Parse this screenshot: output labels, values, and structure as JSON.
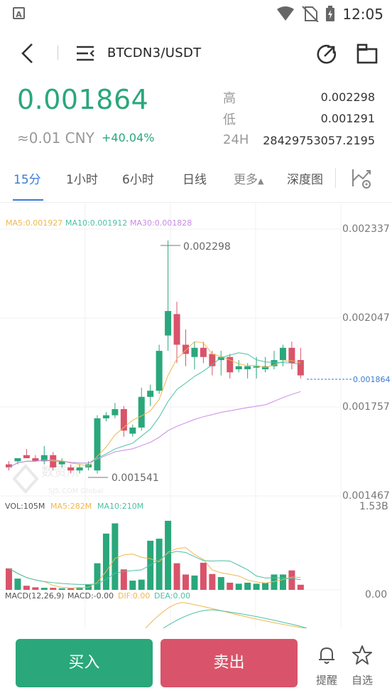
{
  "status_bar": {
    "time": "12:05",
    "app_badge": "A"
  },
  "header": {
    "pair": "BTCDN3/USDT"
  },
  "ticker": {
    "price": "0.001864",
    "cny": "≈0.01 CNY",
    "change": "+40.04%",
    "high_label": "高",
    "high_value": "0.002298",
    "low_label": "低",
    "low_value": "0.001291",
    "vol_label": "24H",
    "vol_value": "28429753057.2195"
  },
  "tabs": [
    {
      "label": "15分"
    },
    {
      "label": "1小时"
    },
    {
      "label": "6小时"
    },
    {
      "label": "日线"
    },
    {
      "label": "更多"
    },
    {
      "label": "深度图"
    }
  ],
  "colors": {
    "up": "#2aa77b",
    "down": "#d9546a",
    "ma5": "#f0b74e",
    "ma10": "#4cc0a5",
    "ma30": "#c98ae8",
    "accent": "#3a7bd5"
  },
  "chart_data": {
    "type": "candlestick",
    "legend": {
      "ma5": "MA5:0.001927",
      "ma10": "MA10:0.001912",
      "ma30": "MA30:0.001828"
    },
    "y_ticks": [
      "0.002337",
      "0.002047",
      "0.001757",
      "0.001467"
    ],
    "ylim": [
      0.001467,
      0.002337
    ],
    "max_label": "0.002298",
    "min_label": "0.001541",
    "last_price_label": "0.001864",
    "watermark": "SJS.COM Global",
    "candles": [
      [
        0.00157,
        0.00158,
        0.00156,
        0.00155
      ],
      [
        0.00158,
        0.00159,
        0.00159,
        0.00157
      ],
      [
        0.0016,
        0.00162,
        0.00159,
        0.00159
      ],
      [
        0.00159,
        0.0016,
        0.00158,
        0.00158
      ],
      [
        0.00158,
        0.00163,
        0.0016,
        0.00157
      ],
      [
        0.0016,
        0.00161,
        0.00156,
        0.00155
      ],
      [
        0.00157,
        0.00159,
        0.00158,
        0.00156
      ],
      [
        0.00156,
        0.00157,
        0.00155,
        0.00154
      ],
      [
        0.00155,
        0.00157,
        0.00156,
        0.00154
      ],
      [
        0.00156,
        0.00158,
        0.00157,
        0.00155
      ],
      [
        0.00155,
        0.00173,
        0.00172,
        0.00154
      ],
      [
        0.00172,
        0.00174,
        0.00173,
        0.00171
      ],
      [
        0.00173,
        0.00177,
        0.00175,
        0.00172
      ],
      [
        0.00175,
        0.00176,
        0.00168,
        0.00166
      ],
      [
        0.00167,
        0.0017,
        0.00169,
        0.00166
      ],
      [
        0.00169,
        0.00182,
        0.00179,
        0.00168
      ],
      [
        0.00179,
        0.00183,
        0.00181,
        0.00176
      ],
      [
        0.00181,
        0.00196,
        0.00194,
        0.0018
      ],
      [
        0.00199,
        0.0023,
        0.00207,
        0.00194
      ],
      [
        0.00206,
        0.0021,
        0.00196,
        0.0019
      ],
      [
        0.00196,
        0.00201,
        0.00193,
        0.00189
      ],
      [
        0.00192,
        0.00197,
        0.00195,
        0.00188
      ],
      [
        0.00195,
        0.00197,
        0.00192,
        0.0019
      ],
      [
        0.00193,
        0.00194,
        0.00189,
        0.00186
      ],
      [
        0.00191,
        0.00194,
        0.00192,
        0.00186
      ],
      [
        0.00192,
        0.00193,
        0.00187,
        0.00185
      ],
      [
        0.00188,
        0.00191,
        0.00189,
        0.00187
      ],
      [
        0.00188,
        0.0019,
        0.00189,
        0.00185
      ],
      [
        0.00189,
        0.00192,
        0.00189,
        0.00185
      ],
      [
        0.00188,
        0.00192,
        0.00189,
        0.00187
      ],
      [
        0.00189,
        0.00194,
        0.00191,
        0.00188
      ],
      [
        0.00191,
        0.00196,
        0.00195,
        0.00189
      ],
      [
        0.00195,
        0.00197,
        0.0019,
        0.00188
      ],
      [
        0.00191,
        0.00195,
        0.00186,
        0.00185
      ]
    ],
    "volume": {
      "legend": {
        "vol": "VOL:105M",
        "ma5": "MA5:282M",
        "ma10": "MA10:210M"
      },
      "top_label": "1.53B",
      "values": [
        0.42,
        0.22,
        0.08,
        0.05,
        0.04,
        0.04,
        0.03,
        0.03,
        0.05,
        0.1,
        0.52,
        1.1,
        1.3,
        0.4,
        0.18,
        0.2,
        0.96,
        1.0,
        1.35,
        0.52,
        0.3,
        0.28,
        0.53,
        0.31,
        0.25,
        0.14,
        0.12,
        0.14,
        0.12,
        0.14,
        0.3,
        0.3,
        0.38,
        0.1
      ]
    },
    "macd": {
      "legend": {
        "title": "MACD(12,26,9)",
        "macd": "MACD:-0.00",
        "dif": "DIF:0.00",
        "dea": "DEA:0.00"
      },
      "zero_label": "0.00"
    }
  },
  "bottom": {
    "buy": "买入",
    "sell": "卖出",
    "alert": "提醒",
    "favorite": "自选"
  }
}
